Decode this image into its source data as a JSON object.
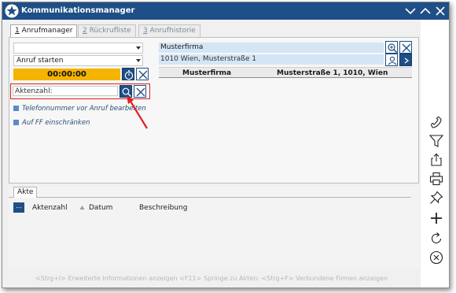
{
  "window": {
    "title": "Kommunikationsmanager"
  },
  "tabs": [
    {
      "num": "1",
      "label": " Anrufmanager",
      "active": true
    },
    {
      "num": "2",
      "label": " Rückrufliste",
      "active": false
    },
    {
      "num": "3",
      "label": " Anrufhistorie",
      "active": false
    }
  ],
  "left": {
    "combo1": "",
    "combo2": "Anruf starten",
    "timer": "00:00:00",
    "akten_label": "Aktenzahl:",
    "check1": "Telefonnummer vor Anruf bearbeiten",
    "check2": "Auf FF einschränken"
  },
  "company": {
    "name": "Musterfirma",
    "address": "1010 Wien, Musterstraße 1"
  },
  "table": {
    "columns": [
      "Musterfirma",
      "Musterstraße 1, 1010, Wien"
    ]
  },
  "lower": {
    "tab": "Akte",
    "dots": "...",
    "columns": [
      "Aktenzahl",
      "Datum",
      "Beschreibung"
    ]
  },
  "footer": "<Strg+I> Erweiterte Informationen anzeigen <F11> Springe zu Akten: <Strg+F> Verbundene Firmen anzeigen",
  "toolbar": [
    "phone-icon",
    "filter-icon",
    "share-icon",
    "print-icon",
    "pin-icon",
    "plus-icon",
    "refresh-icon",
    "cancel-icon"
  ],
  "colors": {
    "titlebar": "#1e4f86",
    "timer": "#f4b400",
    "highlight": "#e02020",
    "field_blue": "#d4e6f5"
  }
}
